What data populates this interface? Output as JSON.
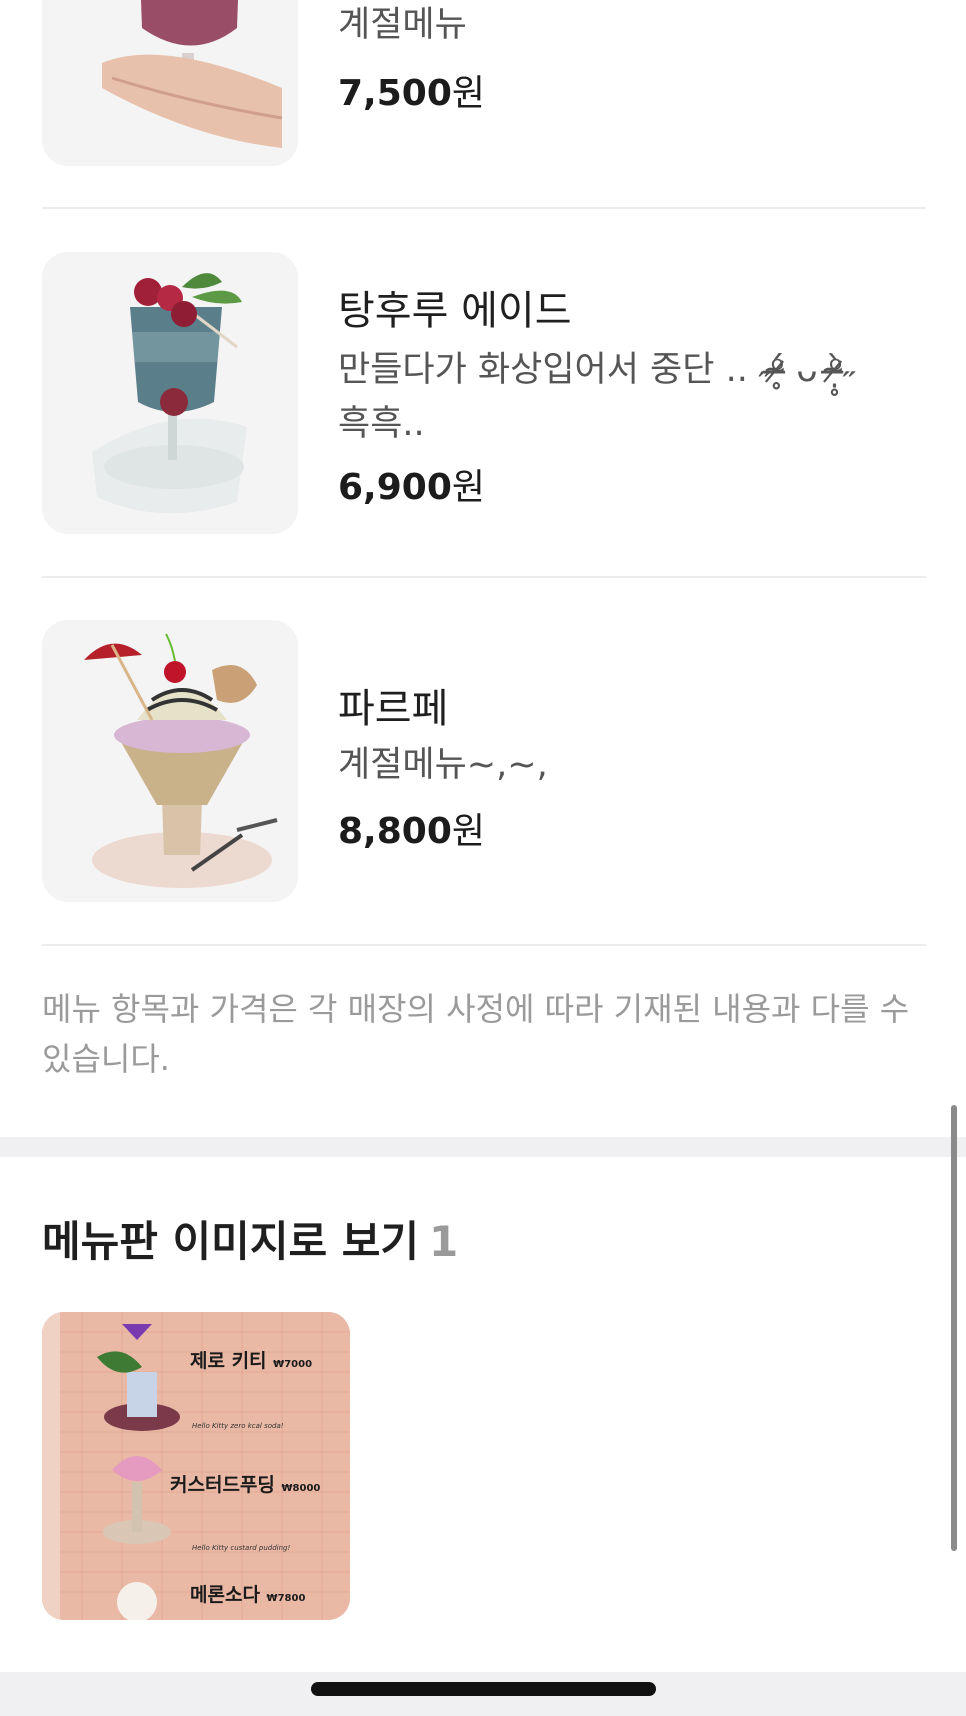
{
  "menu_items": [
    {
      "name": "",
      "description": "계절메뉴",
      "price_number": "7,500",
      "price_unit": "원",
      "image_icon": "cocktail-glass-photo"
    },
    {
      "name": "탕후루 에이드",
      "description": "만들다가 화상입어서 중단 .. ˶ᵒ̴̶̷̥́ ᴗ ᵒ̴̶̷̣̥̀˶ 흑흑..",
      "price_number": "6,900",
      "price_unit": "원",
      "image_icon": "tanghulu-ade-photo"
    },
    {
      "name": "파르페",
      "description": "계절메뉴~,~,",
      "price_number": "8,800",
      "price_unit": "원",
      "image_icon": "parfait-photo"
    }
  ],
  "notice": "메뉴 항목과 가격은 각 매장의 사정에 따라 기재된 내용과 다를 수 있습니다.",
  "menu_board_section": {
    "title": "메뉴판 이미지로 보기",
    "count": "1",
    "board_lines": [
      {
        "title": "제로 키티",
        "price": "₩7000",
        "caption": "Hello Kitty zero kcal soda!"
      },
      {
        "title": "커스터드푸딩",
        "price": "₩8000",
        "caption": "Hello Kitty custard pudding!"
      },
      {
        "title": "메론소다",
        "price": "₩7800",
        "caption": ""
      }
    ]
  },
  "colors": {
    "accent_text": "#1c1c1c",
    "muted_text": "#9a9a9a",
    "divider": "#ececec",
    "board_bg": "#e9b8a4"
  }
}
